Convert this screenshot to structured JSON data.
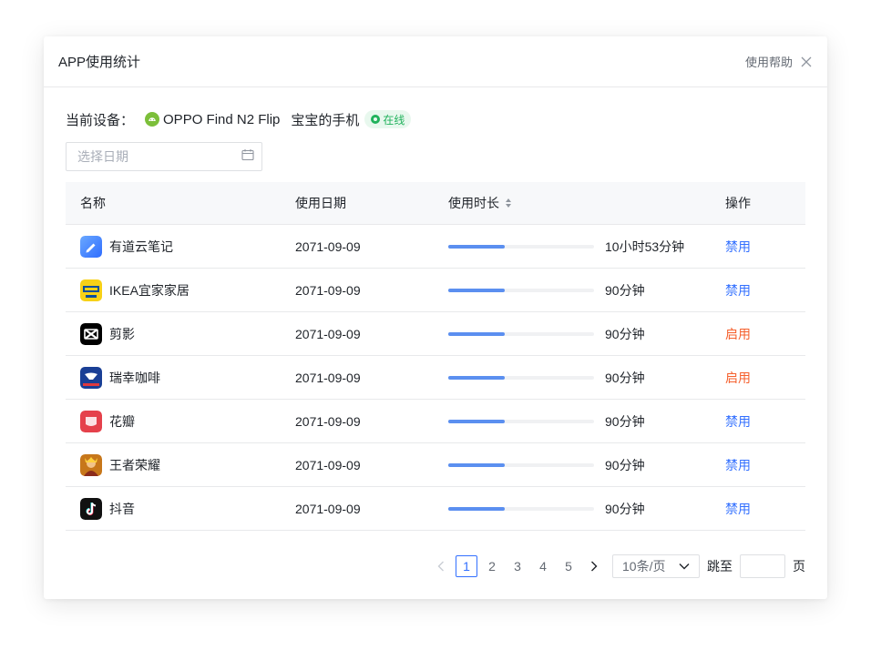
{
  "dialog": {
    "title": "APP使用统计",
    "help_label": "使用帮助"
  },
  "device": {
    "label": "当前设备：",
    "model": "OPPO Find N2 Flip",
    "name": "宝宝的手机",
    "status": "在线",
    "status_color": "#21b25c"
  },
  "date_picker": {
    "placeholder": "选择日期",
    "value": ""
  },
  "table": {
    "columns": {
      "name": "名称",
      "date": "使用日期",
      "duration": "使用时长",
      "action": "操作"
    },
    "rows": [
      {
        "icon": "youdao-note-icon",
        "name": "有道云笔记",
        "date": "2071-09-09",
        "progress": 0.39,
        "duration": "10小时53分钟",
        "action": "禁用",
        "action_color": "#3370ff"
      },
      {
        "icon": "ikea-icon",
        "name": "IKEA宜家家居",
        "date": "2071-09-09",
        "progress": 0.39,
        "duration": "90分钟",
        "action": "禁用",
        "action_color": "#3370ff"
      },
      {
        "icon": "capcut-icon",
        "name": "剪影",
        "date": "2071-09-09",
        "progress": 0.39,
        "duration": "90分钟",
        "action": "启用",
        "action_color": "#f5602d"
      },
      {
        "icon": "luckin-coffee-icon",
        "name": "瑞幸咖啡",
        "date": "2071-09-09",
        "progress": 0.39,
        "duration": "90分钟",
        "action": "启用",
        "action_color": "#f5602d"
      },
      {
        "icon": "huaban-icon",
        "name": "花瓣",
        "date": "2071-09-09",
        "progress": 0.39,
        "duration": "90分钟",
        "action": "禁用",
        "action_color": "#3370ff"
      },
      {
        "icon": "honor-of-kings-icon",
        "name": "王者荣耀",
        "date": "2071-09-09",
        "progress": 0.39,
        "duration": "90分钟",
        "action": "禁用",
        "action_color": "#3370ff"
      },
      {
        "icon": "douyin-icon",
        "name": "抖音",
        "date": "2071-09-09",
        "progress": 0.39,
        "duration": "90分钟",
        "action": "禁用",
        "action_color": "#3370ff"
      }
    ]
  },
  "pagination": {
    "pages": [
      "1",
      "2",
      "3",
      "4",
      "5"
    ],
    "current": "1",
    "page_size": "10条/页",
    "jump_label": "跳至",
    "page_label": "页",
    "jump_value": ""
  },
  "colors": {
    "accent": "#3370ff",
    "progress": "#5b8ff0",
    "enable": "#f5602d"
  }
}
